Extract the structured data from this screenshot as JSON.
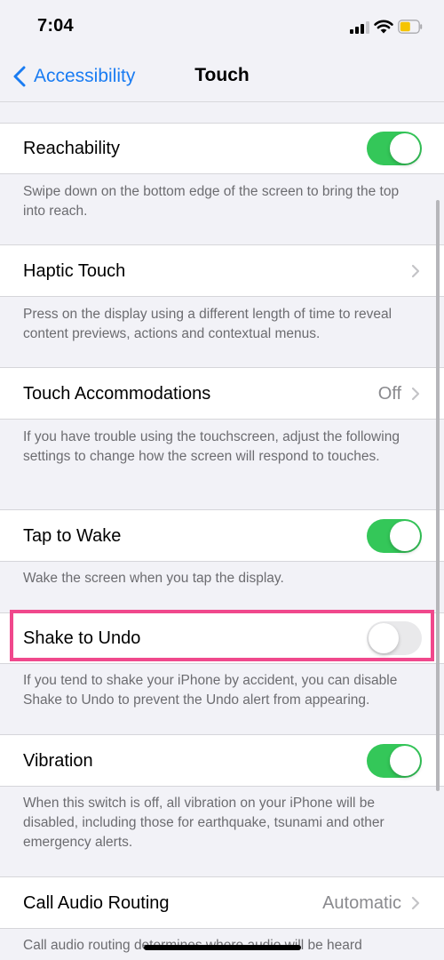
{
  "status_bar": {
    "time": "7:04",
    "battery_color": "#f5c400"
  },
  "nav": {
    "back_label": "Accessibility",
    "title": "Touch"
  },
  "settings": {
    "reachability": {
      "label": "Reachability",
      "enabled": true,
      "footer": "Swipe down on the bottom edge of the screen to bring the top into reach."
    },
    "haptic_touch": {
      "label": "Haptic Touch",
      "footer": "Press on the display using a different length of time to reveal content previews, actions and contextual menus."
    },
    "touch_accommodations": {
      "label": "Touch Accommodations",
      "value": "Off",
      "footer": "If you have trouble using the touchscreen, adjust the following settings to change how the screen will respond to touches."
    },
    "tap_to_wake": {
      "label": "Tap to Wake",
      "enabled": true,
      "footer": "Wake the screen when you tap the display."
    },
    "shake_to_undo": {
      "label": "Shake to Undo",
      "enabled": false,
      "footer": "If you tend to shake your iPhone by accident, you can disable Shake to Undo to prevent the Undo alert from appearing."
    },
    "vibration": {
      "label": "Vibration",
      "enabled": true,
      "footer": "When this switch is off, all vibration on your iPhone will be disabled, including those for earthquake, tsunami and other emergency alerts."
    },
    "call_audio_routing": {
      "label": "Call Audio Routing",
      "value": "Automatic",
      "footer": "Call audio routing determines where audio will be heard"
    }
  },
  "colors": {
    "accent": "#1a7cf2",
    "toggle_on": "#34c759",
    "highlight": "#f0488c"
  }
}
